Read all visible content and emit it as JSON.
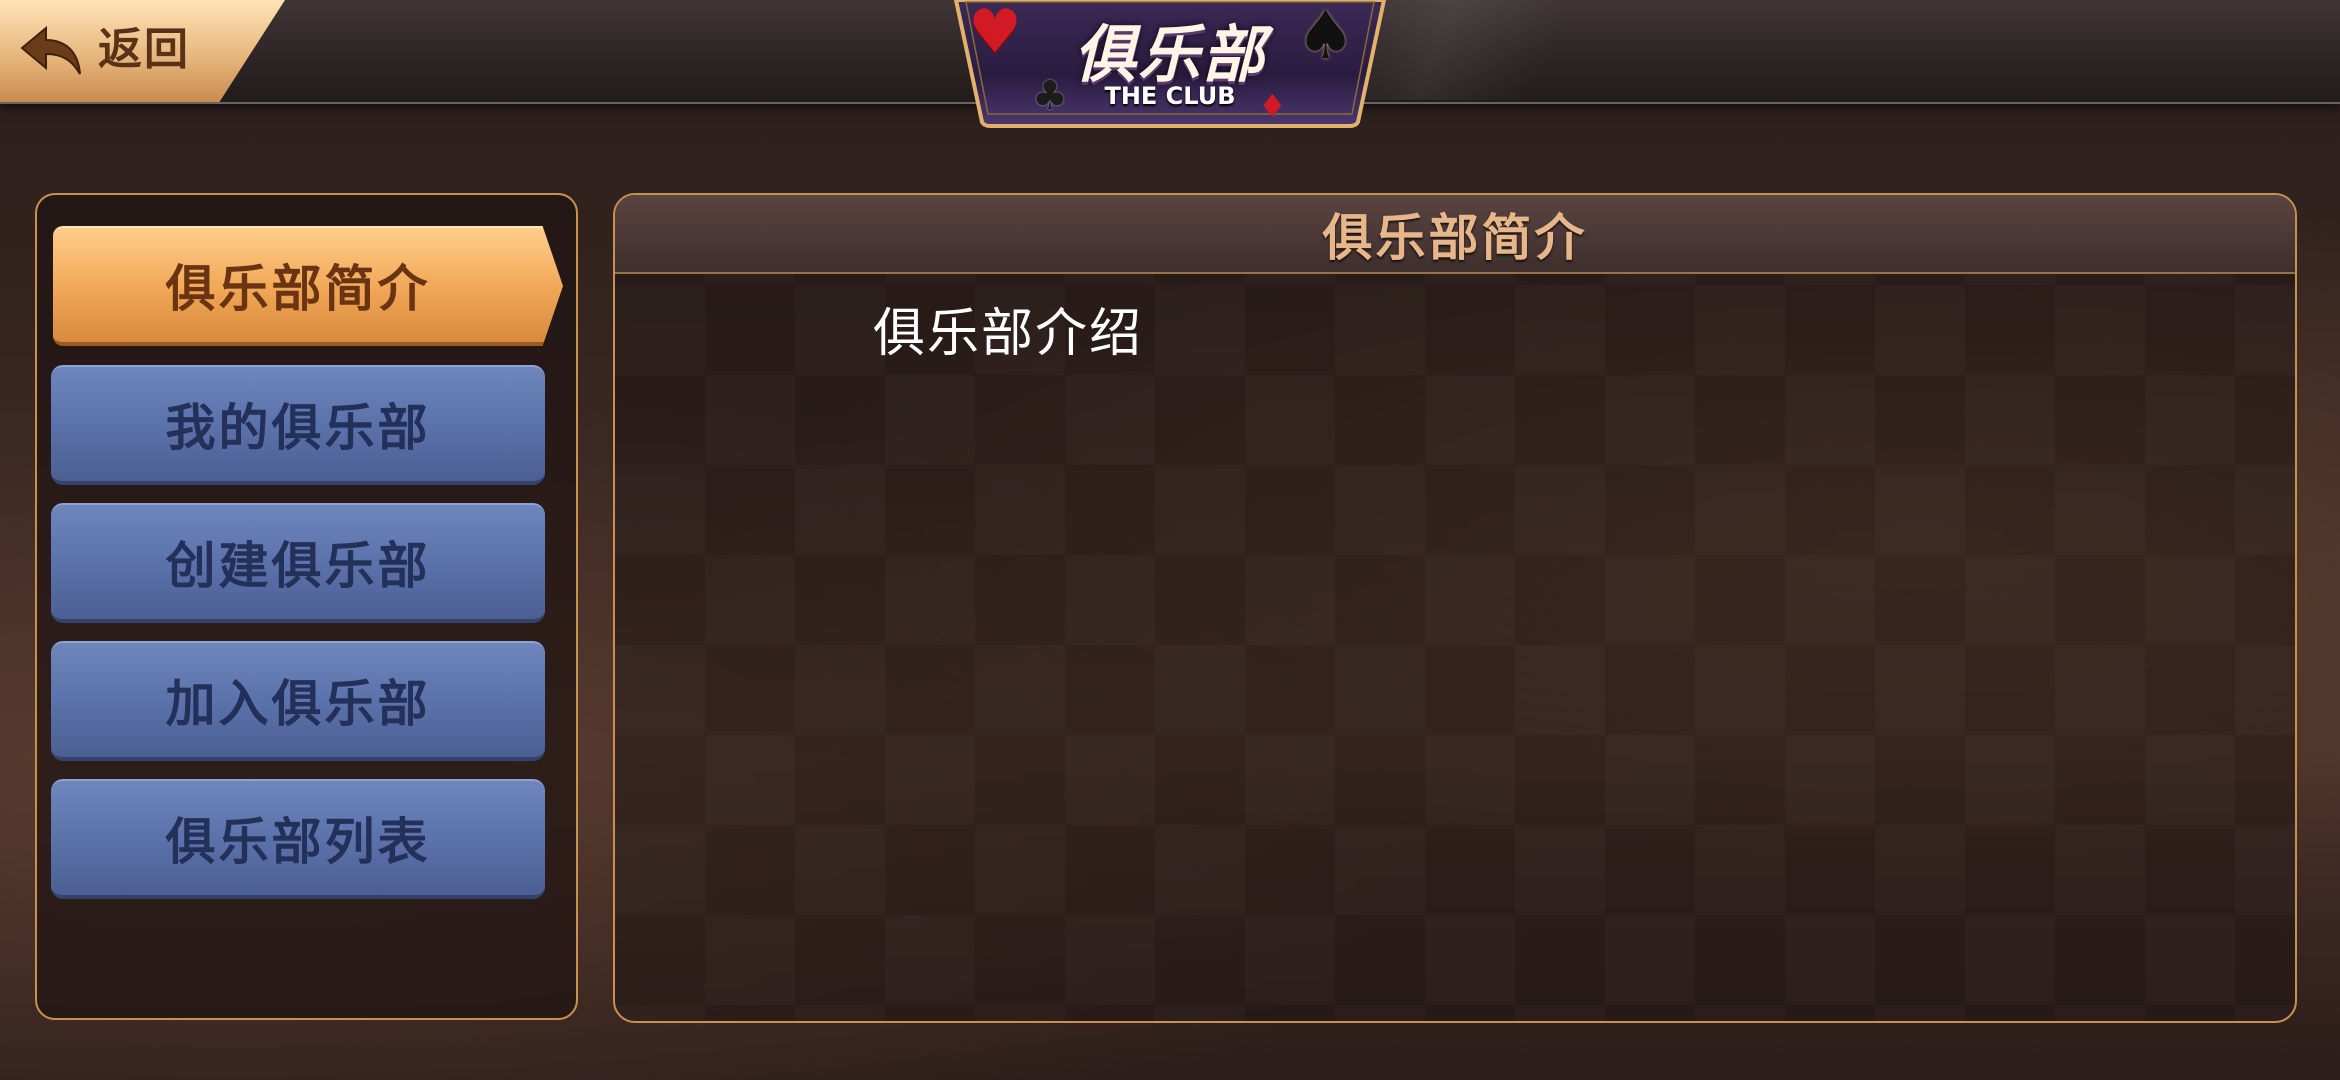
{
  "header": {
    "back_label": "返回",
    "title": "俱乐部",
    "subtitle": "THE CLUB",
    "title_icons": [
      "heart-icon",
      "spade-icon",
      "club-icon",
      "diamond-icon"
    ]
  },
  "sidebar": {
    "items": [
      {
        "label": "俱乐部简介",
        "active": true
      },
      {
        "label": "我的俱乐部",
        "active": false
      },
      {
        "label": "创建俱乐部",
        "active": false
      },
      {
        "label": "加入俱乐部",
        "active": false
      },
      {
        "label": "俱乐部列表",
        "active": false
      }
    ]
  },
  "main": {
    "panel_title": "俱乐部简介",
    "content": "俱乐部介绍"
  },
  "colors": {
    "accent_gold": "#c9914f",
    "active_tab": "#f0a656",
    "inactive_tab": "#5a70a8",
    "panel_title": "#e7b68a"
  }
}
